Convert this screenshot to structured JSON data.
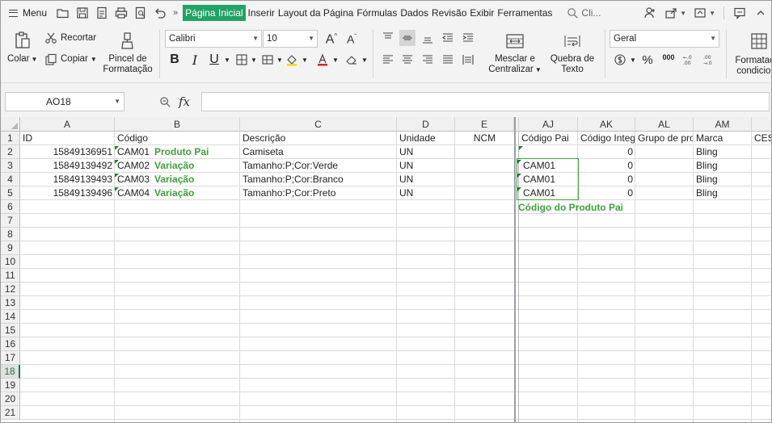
{
  "menubar": {
    "menu_label": "Menu",
    "tabs": [
      "Página Inicial",
      "Inserir",
      "Layout da Página",
      "Fórmulas",
      "Dados",
      "Revisão",
      "Exibir",
      "Ferramentas"
    ],
    "active_tab": "Página Inicial",
    "search_placeholder": "Cli...",
    "more_chevron": "»"
  },
  "ribbon": {
    "clipboard": {
      "paste_label": "Colar",
      "cut_label": "Recortar",
      "copy_label": "Copiar",
      "format_painter_label_1": "Pincel de",
      "format_painter_label_2": "Formatação"
    },
    "font": {
      "font_name": "Calibri",
      "font_size": "10",
      "bold": "B",
      "italic": "I",
      "underline": "U"
    },
    "alignment": {
      "merge_label_1": "Mesclar e",
      "merge_label_2": "Centralizar",
      "wrap_label_1": "Quebra de",
      "wrap_label_2": "Texto"
    },
    "number": {
      "format": "Geral",
      "percent": "%",
      "thousands": "000"
    },
    "styles": {
      "conditional_label_1": "Formatação",
      "conditional_label_2": "condicional"
    }
  },
  "formula_bar": {
    "name_box": "AO18",
    "fx_label": "fx",
    "formula": ""
  },
  "grid": {
    "columns": [
      "A",
      "B",
      "C",
      "D",
      "E",
      "AJ",
      "AK",
      "AL",
      "AM"
    ],
    "rows": [
      "1",
      "2",
      "3",
      "4",
      "5",
      "6",
      "7",
      "8",
      "9",
      "10",
      "11",
      "12",
      "13",
      "14",
      "15",
      "16",
      "17",
      "18",
      "19",
      "20",
      "21"
    ],
    "active_row": "18",
    "header_row": {
      "id": "ID",
      "codigo": "Código",
      "descricao": "Descrição",
      "unidade": "Unidade",
      "ncm": "NCM",
      "codigo_pai": "Código Pai",
      "codigo_integ": "Código Integ",
      "grupo": "Grupo de pro",
      "marca": "Marca",
      "cest": "CEST"
    },
    "data_rows": [
      {
        "id": "15849136951",
        "codigo": "CAM01",
        "descricao": "Camiseta",
        "unidade": "UN",
        "codigo_pai": "",
        "codigo_integ": "0",
        "marca": "Bling"
      },
      {
        "id": "15849139492",
        "codigo": "CAM02",
        "descricao": "Tamanho:P;Cor:Verde",
        "unidade": "UN",
        "codigo_pai": "CAM01",
        "codigo_integ": "0",
        "marca": "Bling"
      },
      {
        "id": "15849139493",
        "codigo": "CAM03",
        "descricao": "Tamanho:P;Cor:Branco",
        "unidade": "UN",
        "codigo_pai": "CAM01",
        "codigo_integ": "0",
        "marca": "Bling"
      },
      {
        "id": "15849139496",
        "codigo": "CAM04",
        "descricao": "Tamanho:P;Cor:Preto",
        "unidade": "UN",
        "codigo_pai": "CAM01",
        "codigo_integ": "0",
        "marca": "Bling"
      }
    ],
    "annotations": {
      "parent": "Produto Pai",
      "variation": "Variação",
      "parent_code": "Código do Produto Pai"
    },
    "accent_color": "#3f9f3f",
    "active_tab_color": "#21a366"
  }
}
